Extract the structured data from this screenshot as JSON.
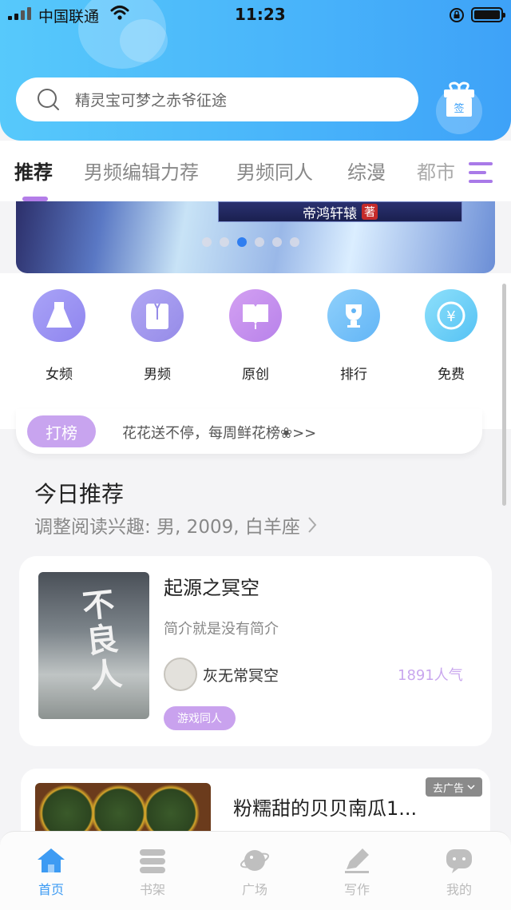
{
  "status_bar": {
    "carrier": "中国联通",
    "time": "11:23"
  },
  "search": {
    "placeholder": "精灵宝可梦之赤爷征途"
  },
  "gift": {
    "label": "签"
  },
  "tabs": [
    {
      "label": "推荐",
      "active": true
    },
    {
      "label": "男频编辑力荐"
    },
    {
      "label": "男频同人"
    },
    {
      "label": "综漫"
    },
    {
      "label": "都市"
    }
  ],
  "banner": {
    "author_text": "帝鸿轩辕",
    "seal": "著",
    "active_dot": 2
  },
  "categories": [
    {
      "label": "女频",
      "icon": "dress-icon"
    },
    {
      "label": "男频",
      "icon": "shirt-icon"
    },
    {
      "label": "原创",
      "icon": "book-icon"
    },
    {
      "label": "排行",
      "icon": "trophy-icon"
    },
    {
      "label": "免费",
      "icon": "yen-icon"
    }
  ],
  "rank": {
    "badge": "打榜",
    "text": "花花送不停，每周鲜花榜❀>>"
  },
  "today": {
    "title": "今日推荐",
    "subtitle": "调整阅读兴趣: 男, 2009, 白羊座"
  },
  "book": {
    "cover_text": "不良人",
    "title": "起源之冥空",
    "intro": "简介就是没有简介",
    "author": "灰无常冥空",
    "popularity": "1891人气",
    "tag": "游戏同人"
  },
  "ad": {
    "title": "粉糯甜的贝贝南瓜1...",
    "close_label": "去广告"
  },
  "bottom_nav": [
    {
      "label": "首页",
      "icon": "home-icon",
      "active": true
    },
    {
      "label": "书架",
      "icon": "bookshelf-icon"
    },
    {
      "label": "广场",
      "icon": "planet-icon"
    },
    {
      "label": "写作",
      "icon": "pen-icon"
    },
    {
      "label": "我的",
      "icon": "chat-icon"
    }
  ],
  "colors": {
    "header": "#48b3fa",
    "accent": "#b37de8",
    "nav_active": "#3d9bf3"
  }
}
